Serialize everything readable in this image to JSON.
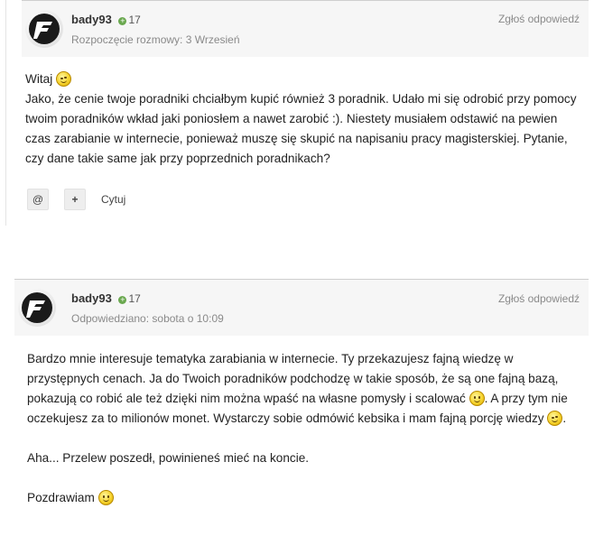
{
  "posts": [
    {
      "author": "bady93",
      "reputation": "17",
      "meta": "Rozpoczęcie rozmowy: 3 Wrzesień",
      "report": "Zgłoś odpowiedź",
      "paragraphs": [
        {
          "text": "Witaj ",
          "emoji": "wink"
        },
        {
          "text": "Jako, że cenie twoje poradniki chciałbym kupić również 3 poradnik. Udało mi się odrobić przy pomocy twoim poradników wkład jaki poniosłem a nawet zarobić :). Niestety musiałem odstawić na pewien czas zarabianie w internecie, ponieważ muszę się skupić na napisaniu pracy magisterskiej. Pytanie, czy dane takie same jak przy poprzednich poradnikach?"
        }
      ],
      "actions": {
        "mention": "@",
        "multiquote": "+",
        "quote": "Cytuj"
      }
    },
    {
      "author": "bady93",
      "reputation": "17",
      "meta": "Odpowiedziano: sobota o 10:09",
      "report": "Zgłoś odpowiedź",
      "p1a": "Bardzo mnie interesuje tematyka zarabiania w internecie. Ty przekazujesz fajną wiedzę w przystępnych cenach. Ja do Twoich poradników podchodzę w takie sposób, że są one fajną bazą, pokazują co robić ale też dzięki nim można wpaść na własne pomysły i scalować ",
      "p1b": ". A przy tym nie oczekujesz za to milionów monet. Wystarczy sobie odmówić kebsika i mam fajną porcję wiedzy ",
      "p1c": ".",
      "p2": "Aha... Przelew poszedł, powinieneś mieć na koncie.",
      "p3": "Pozdrawiam "
    }
  ],
  "colors": {
    "header_bg": "#f6f6f6",
    "meta": "#8a8a8a",
    "rep_icon": "#6aa84f",
    "border": "#cfcfcf"
  },
  "icons": {
    "avatar": "logo-f-avatar",
    "rep": "plus-circle-icon",
    "emoji_smile": "smile-emoji",
    "emoji_wink": "wink-emoji"
  }
}
